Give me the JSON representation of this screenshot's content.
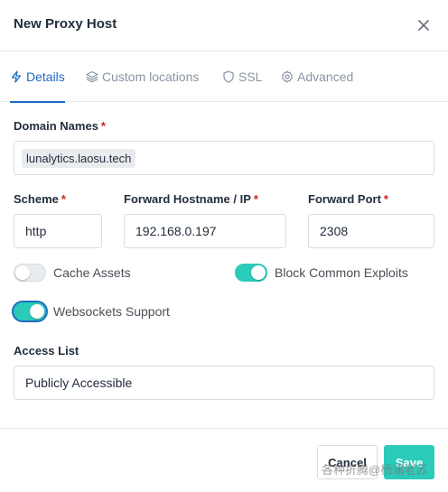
{
  "header": {
    "title": "New Proxy Host",
    "close_icon": "close-icon"
  },
  "tabs": [
    {
      "label": "Details",
      "icon": "bolt-icon",
      "active": true
    },
    {
      "label": "Custom locations",
      "icon": "layers-icon",
      "active": false
    },
    {
      "label": "SSL",
      "icon": "shield-icon",
      "active": false
    },
    {
      "label": "Advanced",
      "icon": "gear-icon",
      "active": false
    }
  ],
  "form": {
    "domain_names": {
      "label": "Domain Names",
      "required_mark": "*",
      "values": [
        "lunalytics.laosu.tech"
      ]
    },
    "scheme": {
      "label": "Scheme",
      "required_mark": "*",
      "value": "http"
    },
    "forward_host": {
      "label": "Forward Hostname / IP",
      "required_mark": "*",
      "value": "192.168.0.197"
    },
    "forward_port": {
      "label": "Forward Port",
      "required_mark": "*",
      "value": "2308"
    },
    "toggles": [
      {
        "label": "Cache Assets",
        "on": false
      },
      {
        "label": "Block Common Exploits",
        "on": true
      },
      {
        "label": "Websockets Support",
        "on": true
      }
    ],
    "access_list": {
      "label": "Access List",
      "value": "Publicly Accessible"
    }
  },
  "footer": {
    "cancel_label": "Cancel",
    "save_label": "Save"
  },
  "watermark": "各种折腾@杨浦老苏",
  "colors": {
    "accent": "#206bc4",
    "toggle_on": "#2bcbba",
    "save_button": "#2bcbba",
    "required": "#cd201f"
  }
}
